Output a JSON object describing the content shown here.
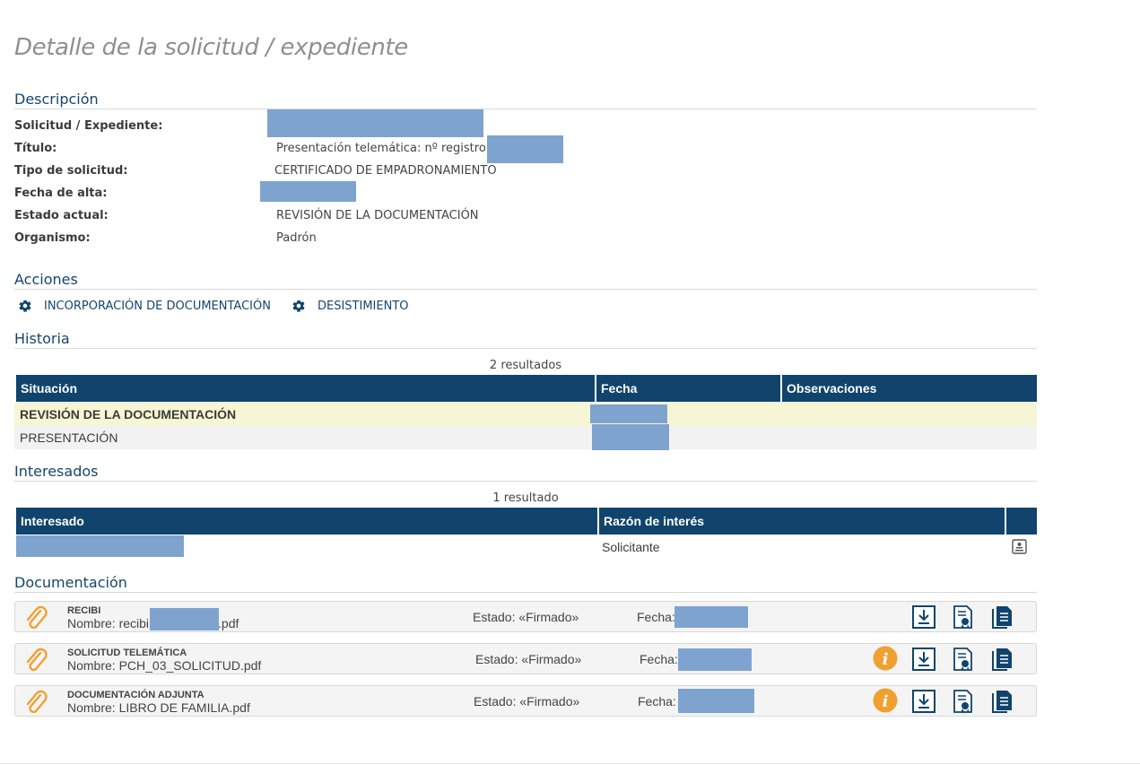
{
  "page": {
    "title": "Detalle de la solicitud / expediente"
  },
  "descripcion": {
    "title": "Descripción",
    "rows": [
      {
        "label": "Solicitud / Expediente:",
        "value": ""
      },
      {
        "label": "Título:",
        "value": "Presentación telemática: nº registro"
      },
      {
        "label": "Tipo de solicitud:",
        "value": "CERTIFICADO DE EMPADRONAMIENTO"
      },
      {
        "label": "Fecha de alta:",
        "value": ""
      },
      {
        "label": "Estado actual:",
        "value": "REVISIÓN DE LA DOCUMENTACIÓN"
      },
      {
        "label": "Organismo:",
        "value": "Padrón"
      }
    ]
  },
  "acciones": {
    "title": "Acciones",
    "items": [
      {
        "label": "INCORPORACIÓN DE DOCUMENTACIÓN",
        "icon": "gear-icon"
      },
      {
        "label": "DESISTIMIENTO",
        "icon": "gear-icon"
      }
    ]
  },
  "historia": {
    "title": "Historia",
    "count": "2 resultados",
    "columns": [
      "Situación",
      "Fecha",
      "Observaciones"
    ],
    "rows": [
      {
        "situacion": "REVISIÓN DE LA DOCUMENTACIÓN",
        "fecha": "",
        "observaciones": "",
        "highlight": true
      },
      {
        "situacion": "PRESENTACIÓN",
        "fecha": "",
        "observaciones": "",
        "highlight": false
      }
    ]
  },
  "interesados": {
    "title": "Interesados",
    "count": "1 resultado",
    "columns": [
      "Interesado",
      "Razón de interés",
      ""
    ],
    "rows": [
      {
        "interesado": "",
        "razon": "Solicitante",
        "icon": "id-card-icon"
      }
    ]
  },
  "documentacion": {
    "title": "Documentación",
    "items": [
      {
        "tipo": "RECIBI",
        "nombre_prefix": "Nombre: recibi",
        "nombre_suffix": ".pdf",
        "estado": "Estado: «Firmado»",
        "fecha_label": "Fecha:",
        "info": false
      },
      {
        "tipo": "SOLICITUD TELEMÁTICA",
        "nombre_prefix": "Nombre: PCH_03_SOLICITUD.pdf",
        "nombre_suffix": "",
        "estado": "Estado: «Firmado»",
        "fecha_label": "Fecha:",
        "info": true
      },
      {
        "tipo": "DOCUMENTACIÓN ADJUNTA",
        "nombre_prefix": "Nombre: LIBRO DE FAMILIA.pdf",
        "nombre_suffix": "",
        "estado": "Estado: «Firmado»",
        "fecha_label": "Fecha:",
        "info": true
      }
    ]
  },
  "colors": {
    "brand": "#10446c",
    "highlight_row": "#f6f6d4",
    "alt_row": "#f2f2f2",
    "info_orange": "#f0a030",
    "redaction": "#7fa3cf"
  }
}
